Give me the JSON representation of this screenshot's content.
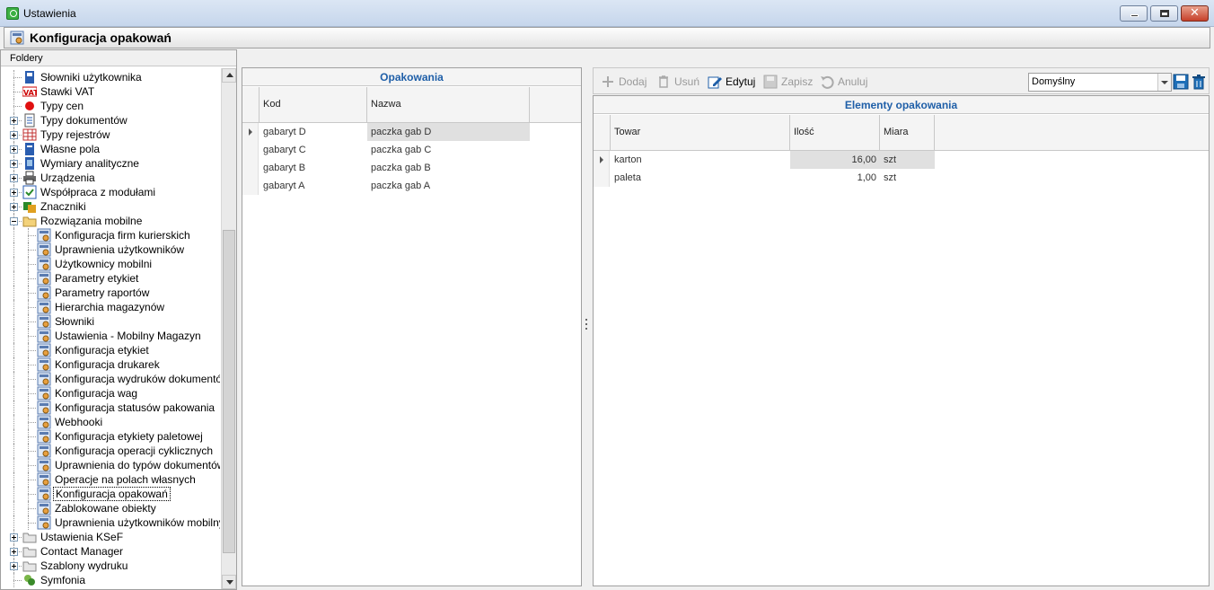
{
  "window": {
    "title": "Ustawienia",
    "controls": {
      "minimize": "minimize",
      "maximize": "maximize",
      "close": "✕"
    }
  },
  "header": {
    "title": "Konfiguracja opakowań"
  },
  "tree": {
    "caption": "Foldery",
    "items": [
      {
        "label": "Słowniki użytkownika",
        "icon": "dictionary-icon",
        "expander": "none",
        "level": 0
      },
      {
        "label": "Stawki VAT",
        "icon": "vat-icon",
        "expander": "none",
        "level": 0
      },
      {
        "label": "Typy cen",
        "icon": "red-dot-icon",
        "expander": "none",
        "level": 0
      },
      {
        "label": "Typy dokumentów",
        "icon": "documents-icon",
        "expander": "plus",
        "level": 0
      },
      {
        "label": "Typy rejestrów",
        "icon": "registers-icon",
        "expander": "plus",
        "level": 0
      },
      {
        "label": "Własne pola",
        "icon": "fields-icon",
        "expander": "plus",
        "level": 0
      },
      {
        "label": "Wymiary analityczne",
        "icon": "dimensions-icon",
        "expander": "plus",
        "level": 0
      },
      {
        "label": "Urządzenia",
        "icon": "printer-icon",
        "expander": "plus",
        "level": 0
      },
      {
        "label": "Współpraca z modułami",
        "icon": "modules-icon",
        "expander": "plus",
        "level": 0
      },
      {
        "label": "Znaczniki",
        "icon": "tags-icon",
        "expander": "plus",
        "level": 0
      },
      {
        "label": "Rozwiązania mobilne",
        "icon": "folder-open-icon",
        "expander": "minus",
        "level": 0
      },
      {
        "label": "Konfiguracja firm kurierskich",
        "icon": "config-icon",
        "expander": "none",
        "level": 1
      },
      {
        "label": "Uprawnienia użytkowników",
        "icon": "config-icon",
        "expander": "none",
        "level": 1
      },
      {
        "label": "Użytkownicy mobilni",
        "icon": "config-icon",
        "expander": "none",
        "level": 1
      },
      {
        "label": "Parametry etykiet",
        "icon": "config-icon",
        "expander": "none",
        "level": 1
      },
      {
        "label": "Parametry raportów",
        "icon": "config-icon",
        "expander": "none",
        "level": 1
      },
      {
        "label": "Hierarchia magazynów",
        "icon": "config-icon",
        "expander": "none",
        "level": 1
      },
      {
        "label": "Słowniki",
        "icon": "config-icon",
        "expander": "none",
        "level": 1
      },
      {
        "label": "Ustawienia - Mobilny Magazyn",
        "icon": "config-icon",
        "expander": "none",
        "level": 1
      },
      {
        "label": "Konfiguracja etykiet",
        "icon": "config-icon",
        "expander": "none",
        "level": 1
      },
      {
        "label": "Konfiguracja drukarek",
        "icon": "config-icon",
        "expander": "none",
        "level": 1
      },
      {
        "label": "Konfiguracja wydruków dokumentów",
        "icon": "config-icon",
        "expander": "none",
        "level": 1
      },
      {
        "label": "Konfiguracja wag",
        "icon": "config-icon",
        "expander": "none",
        "level": 1
      },
      {
        "label": "Konfiguracja statusów pakowania",
        "icon": "config-icon",
        "expander": "none",
        "level": 1
      },
      {
        "label": "Webhooki",
        "icon": "config-icon",
        "expander": "none",
        "level": 1
      },
      {
        "label": "Konfiguracja etykiety paletowej",
        "icon": "config-icon",
        "expander": "none",
        "level": 1
      },
      {
        "label": "Konfiguracja operacji cyklicznych",
        "icon": "config-icon",
        "expander": "none",
        "level": 1
      },
      {
        "label": "Uprawnienia do typów dokumentów",
        "icon": "config-icon",
        "expander": "none",
        "level": 1
      },
      {
        "label": "Operacje na polach własnych",
        "icon": "config-icon",
        "expander": "none",
        "level": 1
      },
      {
        "label": "Konfiguracja opakowań",
        "icon": "config-icon",
        "expander": "none",
        "level": 1,
        "selected": true
      },
      {
        "label": "Zablokowane obiekty",
        "icon": "config-icon",
        "expander": "none",
        "level": 1
      },
      {
        "label": "Uprawnienia użytkowników mobilnych",
        "icon": "config-icon",
        "expander": "none",
        "level": 1
      },
      {
        "label": "Ustawienia KSeF",
        "icon": "folder-icon",
        "expander": "plus",
        "level": 0
      },
      {
        "label": "Contact Manager",
        "icon": "folder-icon",
        "expander": "plus",
        "level": 0
      },
      {
        "label": "Szablony wydruku",
        "icon": "folder-icon",
        "expander": "plus",
        "level": 0
      },
      {
        "label": "Symfonia",
        "icon": "symfonia-icon",
        "expander": "none",
        "level": 0
      }
    ]
  },
  "packages": {
    "title": "Opakowania",
    "columns": [
      "Kod",
      "Nazwa"
    ],
    "rows": [
      {
        "kod": "gabaryt D",
        "nazwa": "paczka gab D",
        "current": true
      },
      {
        "kod": "gabaryt C",
        "nazwa": "paczka gab C"
      },
      {
        "kod": "gabaryt B",
        "nazwa": "paczka gab B"
      },
      {
        "kod": "gabaryt A",
        "nazwa": "paczka gab A"
      }
    ]
  },
  "toolbar": {
    "add": "Dodaj",
    "delete": "Usuń",
    "edit": "Edytuj",
    "save": "Zapisz",
    "cancel": "Anuluj",
    "layout_value": "Domyślny"
  },
  "elements": {
    "title": "Elementy opakowania",
    "columns": [
      "Towar",
      "Ilość",
      "Miara"
    ],
    "rows": [
      {
        "towar": "karton",
        "ilosc": "16,00",
        "miara": "szt",
        "current": true
      },
      {
        "towar": "paleta",
        "ilosc": "1,00",
        "miara": "szt"
      }
    ]
  },
  "colors": {
    "accent_title": "#1f5fa8",
    "selection": "#e0e0e0",
    "close_button": "#c6402a"
  }
}
